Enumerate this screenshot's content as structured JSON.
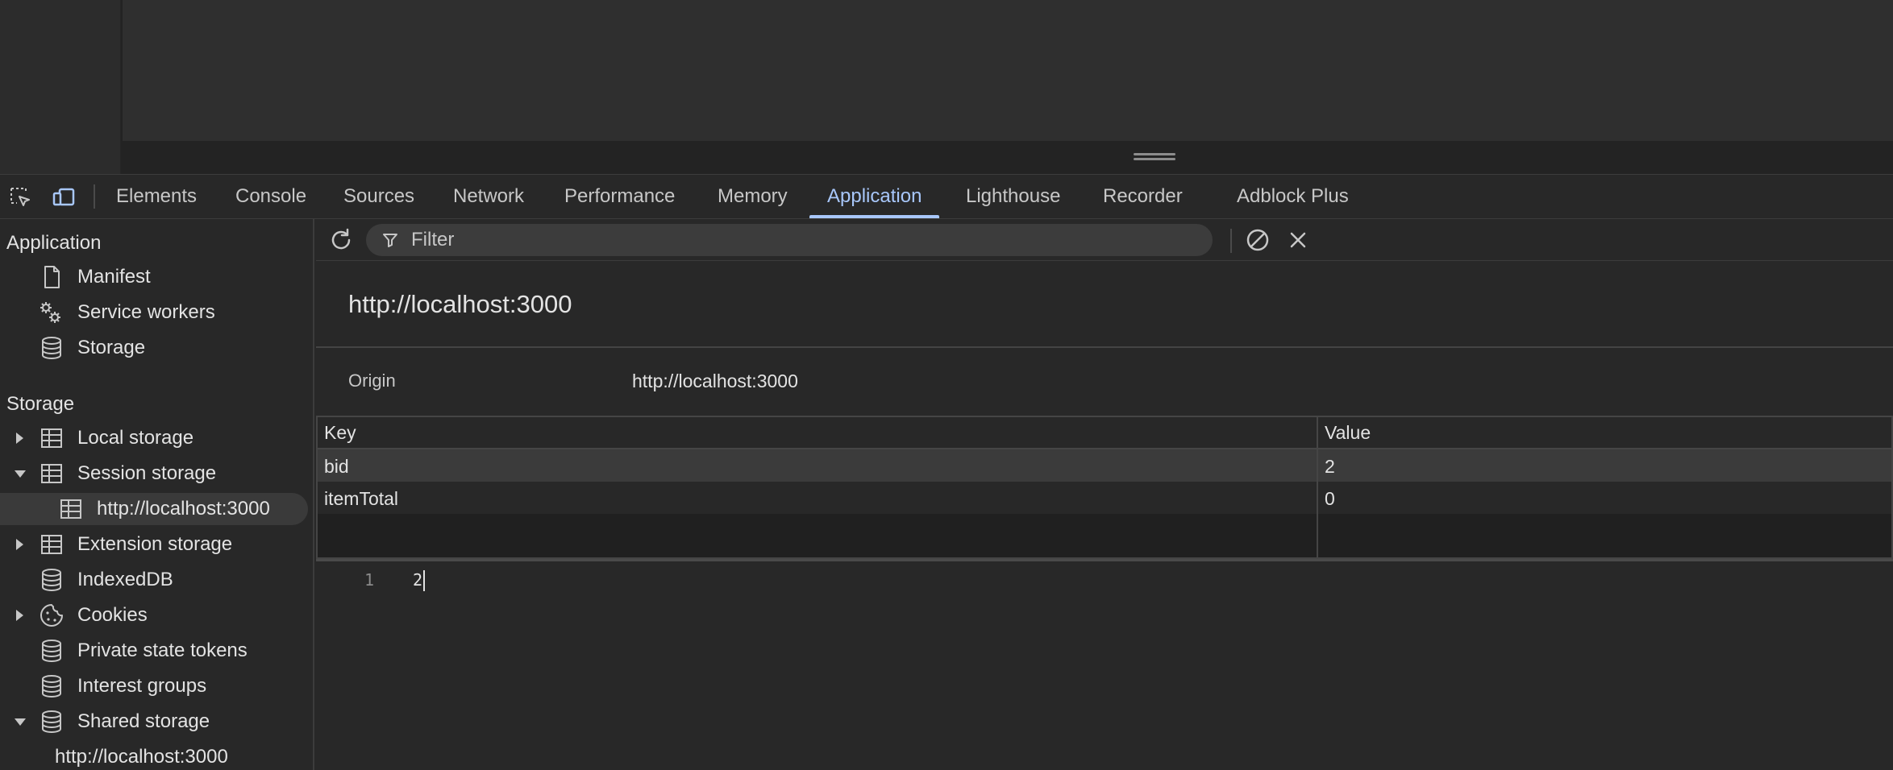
{
  "devtools": {
    "tabs": [
      {
        "label": "Elements"
      },
      {
        "label": "Console"
      },
      {
        "label": "Sources"
      },
      {
        "label": "Network"
      },
      {
        "label": "Performance"
      },
      {
        "label": "Memory"
      },
      {
        "label": "Application",
        "active": true
      },
      {
        "label": "Lighthouse"
      },
      {
        "label": "Recorder"
      },
      {
        "label": "Adblock Plus"
      }
    ],
    "accent_color": "#a8c7fa"
  },
  "sidebar": {
    "application_heading": "Application",
    "application_items": [
      {
        "label": "Manifest",
        "icon": "document-icon"
      },
      {
        "label": "Service workers",
        "icon": "gears-icon"
      },
      {
        "label": "Storage",
        "icon": "database-icon"
      }
    ],
    "storage_heading": "Storage",
    "storage_items": [
      {
        "label": "Local storage",
        "icon": "table-icon",
        "arrow": "collapsed"
      },
      {
        "label": "Session storage",
        "icon": "table-icon",
        "arrow": "expanded"
      },
      {
        "label": "http://localhost:3000",
        "icon": "table-icon",
        "selected": true
      },
      {
        "label": "Extension storage",
        "icon": "table-icon",
        "arrow": "collapsed"
      },
      {
        "label": "IndexedDB",
        "icon": "database-icon"
      },
      {
        "label": "Cookies",
        "icon": "cookie-icon",
        "arrow": "collapsed"
      },
      {
        "label": "Private state tokens",
        "icon": "database-icon"
      },
      {
        "label": "Interest groups",
        "icon": "database-icon"
      },
      {
        "label": "Shared storage",
        "icon": "database-icon",
        "arrow": "expanded"
      },
      {
        "label": "http://localhost:3000"
      }
    ]
  },
  "main": {
    "filter_placeholder": "Filter",
    "title": "http://localhost:3000",
    "origin_label": "Origin",
    "origin_value": "http://localhost:3000",
    "grid": {
      "columns": [
        "Key",
        "Value"
      ],
      "rows": [
        {
          "key": "bid",
          "value": "2"
        },
        {
          "key": "itemTotal",
          "value": "0"
        }
      ]
    },
    "editor": {
      "line_number": "1",
      "line_text": "2"
    }
  }
}
